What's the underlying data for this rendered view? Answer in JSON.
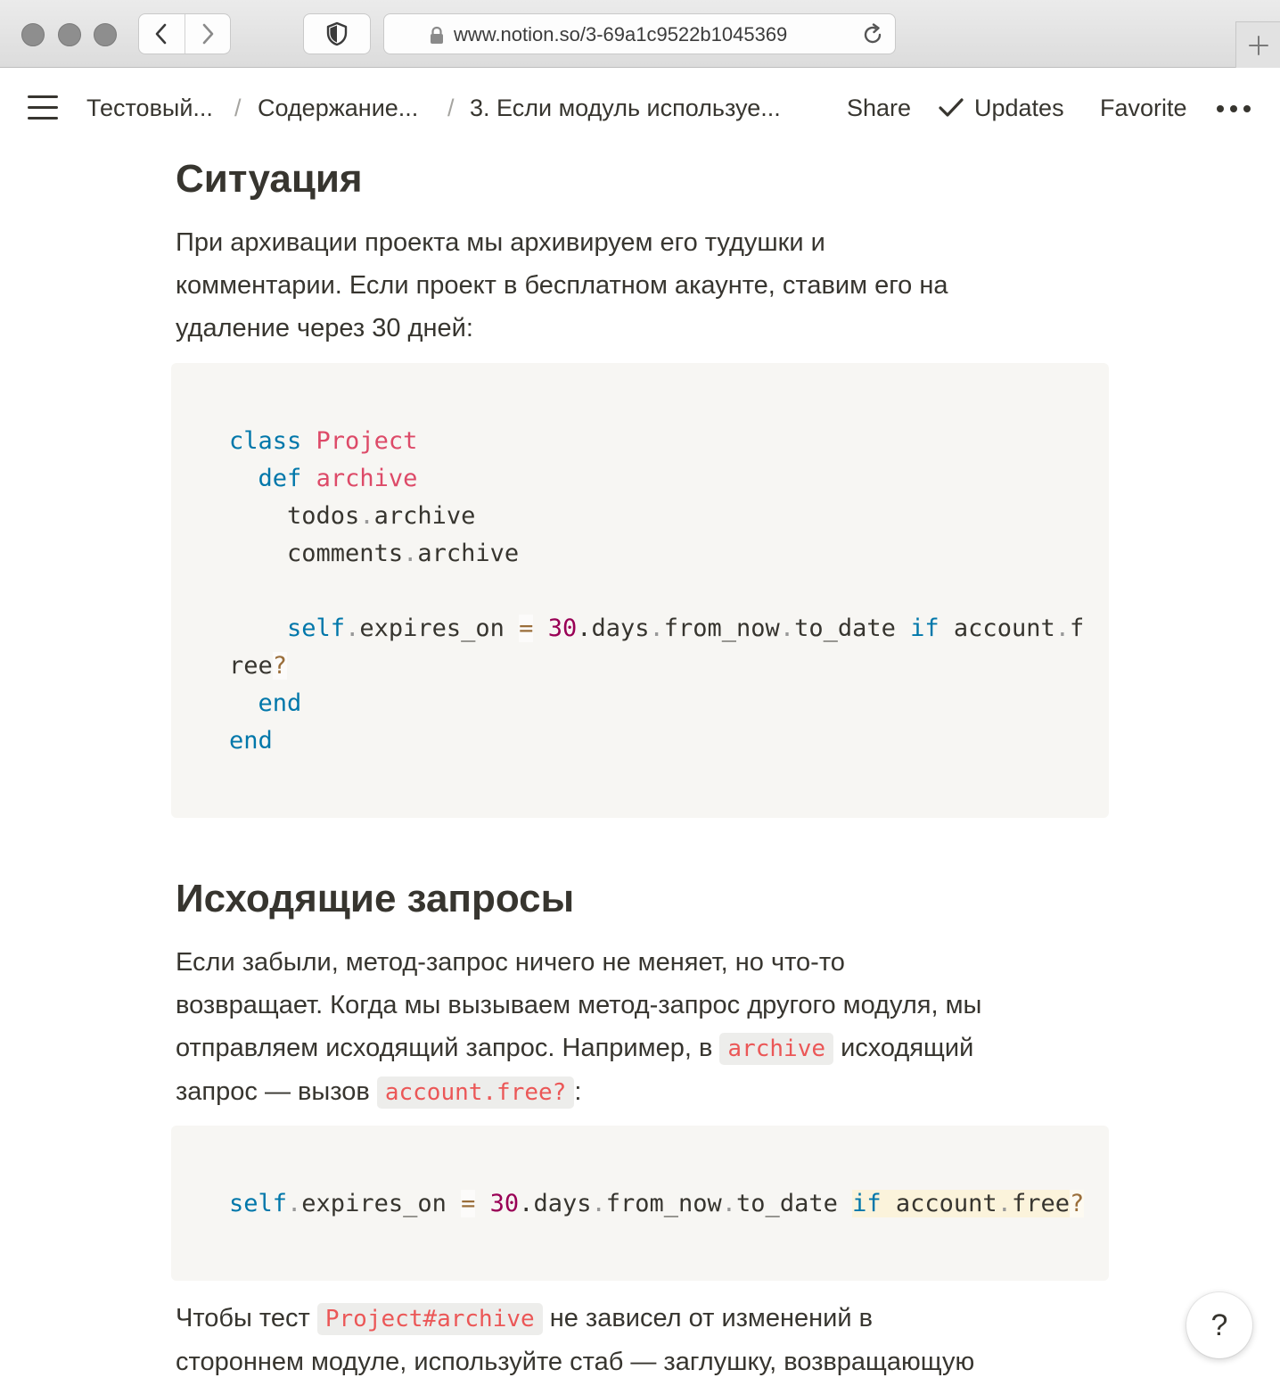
{
  "browser": {
    "url": "www.notion.so/3-69a1c9522b1045369",
    "icons": {
      "back": "chevron-left-icon",
      "forward": "chevron-right-icon",
      "shield": "shield-icon",
      "lock": "lock-icon",
      "reload": "reload-icon",
      "new_tab": "plus-icon"
    }
  },
  "topbar": {
    "breadcrumbs": [
      "Тестовый...",
      "Содержание...",
      "3. Если модуль используе..."
    ],
    "separator": "/",
    "share_label": "Share",
    "updates_label": "Updates",
    "favorite_label": "Favorite"
  },
  "content": {
    "heading1": "Ситуация",
    "para1": [
      "При архивации проекта мы архивируем его тудушки и",
      "комментарии. Если проект в бесплатном акаунте, ставим его на",
      "удаление через 30 дней:"
    ],
    "code1": {
      "kw_class": "class",
      "class_name": "Project",
      "kw_def": "def",
      "method_name": "archive",
      "line3_a": "todos",
      "line3_b": "archive",
      "line4_a": "comments",
      "line4_b": "archive",
      "self": "self",
      "expires": "expires_on",
      "eq": "=",
      "num": "30",
      "days": "days",
      "from_now": "from_now",
      "to_date": "to_date",
      "kw_if": "if",
      "account": "account",
      "f": "f",
      "ree": "ree",
      "qmark": "?",
      "end": "end",
      "dot": "."
    },
    "heading2": "Исходящие запросы",
    "para2": {
      "line1": "Если забыли, метод-запрос ничего не меняет, но что-то",
      "line2": "возвращает. Когда мы вызываем метод-запрос другого модуля, мы",
      "line3_a": "отправляем исходящий запрос. Например, в",
      "line3_code": "archive",
      "line3_b": "исходящий",
      "line4_a": "запрос — вызов",
      "line4_code": "account.free?",
      "line4_b": ":"
    },
    "code2": {
      "self": "self",
      "expires": "expires_on",
      "eq": "=",
      "num": "30",
      "days": "days",
      "from_now": "from_now",
      "to_date": "to_date",
      "kw_if": "if",
      "account": "account",
      "free": "free",
      "qmark": "?",
      "dot": "."
    },
    "para3": {
      "line1_a": "Чтобы тест",
      "line1_code": "Project#archive",
      "line1_b": "не зависел от изменений в",
      "line2": "стороннем модуле, используйте стаб — заглушку, возвращающую"
    }
  },
  "help_button": "?",
  "colors": {
    "text": "#37352f",
    "code_bg": "#f7f6f3",
    "keyword": "#0077aa",
    "class_name": "#dd4a68",
    "number": "#990055",
    "inline_code": "#eb5757"
  }
}
